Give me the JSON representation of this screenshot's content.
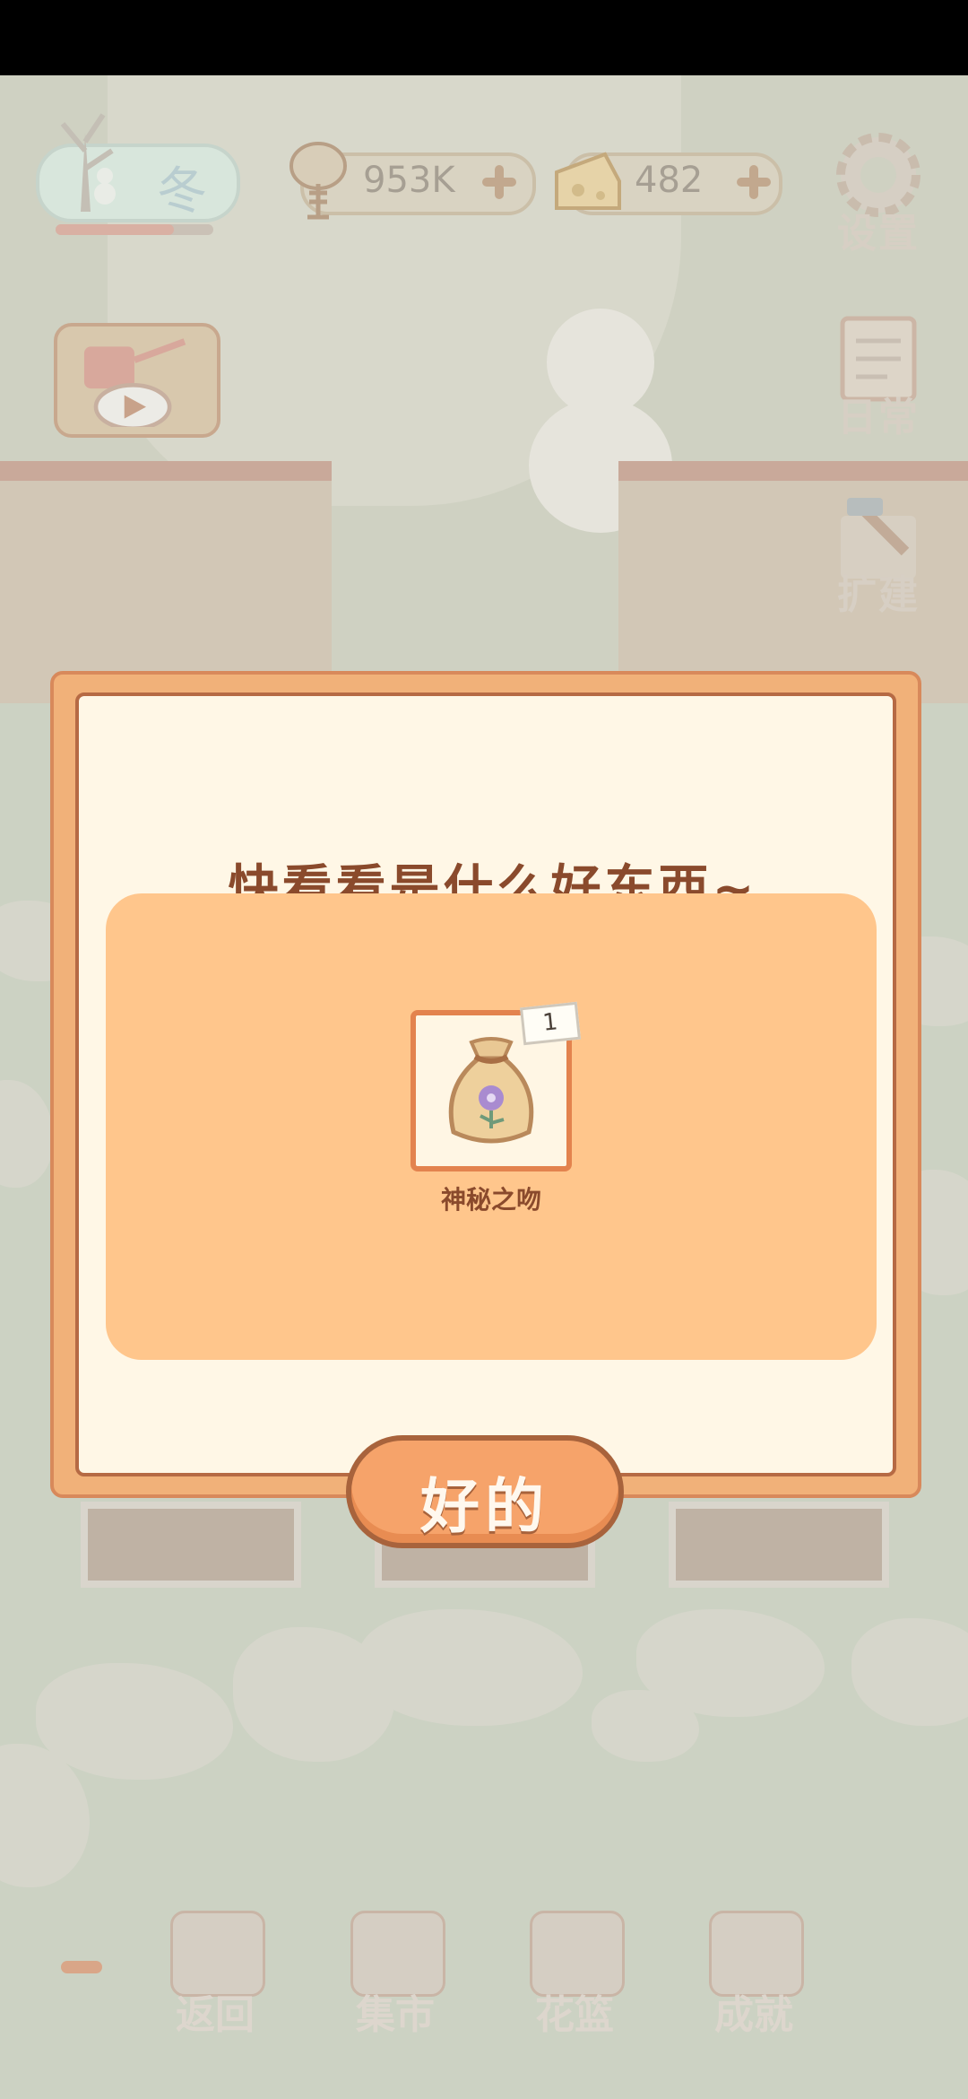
{
  "hud": {
    "season": "冬",
    "season_progress": 0.75,
    "fish_amount": "953K",
    "cheese_amount": "482"
  },
  "side_buttons": {
    "settings": "设置",
    "daily": "日常",
    "expand": "扩建"
  },
  "dialog": {
    "title": "快看看是什么好东西~",
    "item": {
      "name": "神秘之吻",
      "count": "1",
      "icon": "seed-bag-icon"
    },
    "ok_label": "好的"
  },
  "bottom_nav": {
    "items": [
      {
        "label": "返回",
        "icon": "window-icon"
      },
      {
        "label": "集市",
        "icon": "market-stall-icon"
      },
      {
        "label": "花篮",
        "icon": "flower-basket-icon"
      },
      {
        "label": "成就",
        "icon": "trophy-icon"
      }
    ]
  },
  "colors": {
    "dialog_frame": "#f1b179",
    "panel": "#ffc68c",
    "title_text": "#8a4a2c",
    "ok_button": "#f6a36a"
  }
}
